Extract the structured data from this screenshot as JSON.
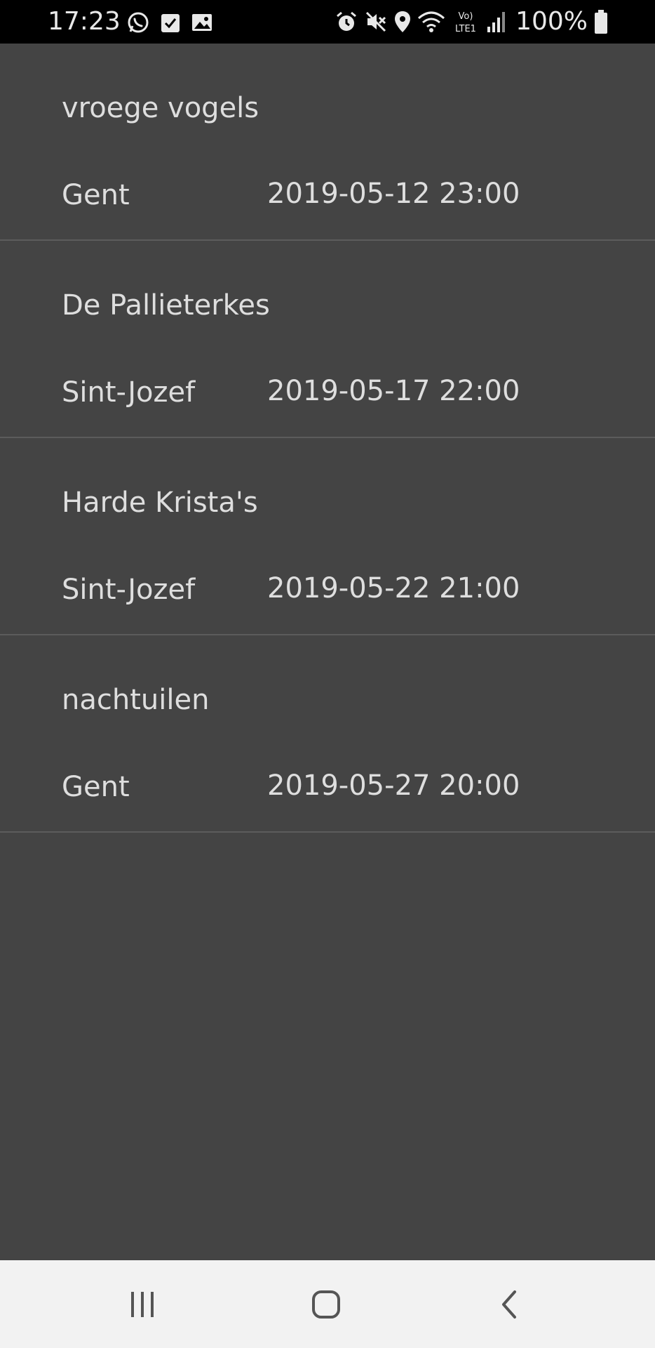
{
  "status_bar": {
    "time": "17:23",
    "battery_percent": "100%",
    "network_label_top": "Vo)",
    "network_label_bottom": "LTE1",
    "left_icons": [
      "whatsapp-icon",
      "checkbox-icon",
      "gallery-icon"
    ],
    "right_icons": [
      "alarm-icon",
      "mute-icon",
      "location-icon",
      "wifi-icon",
      "volte-icon",
      "signal-icon",
      "battery-icon"
    ]
  },
  "events": [
    {
      "title": "vroege vogels",
      "place": "Gent",
      "datetime": "2019-05-12 23:00"
    },
    {
      "title": "De Pallieterkes",
      "place": "Sint-Jozef",
      "datetime": "2019-05-17 22:00"
    },
    {
      "title": "Harde Krista's",
      "place": "Sint-Jozef",
      "datetime": "2019-05-22 21:00"
    },
    {
      "title": "nachtuilen",
      "place": "Gent",
      "datetime": "2019-05-27 20:00"
    }
  ],
  "nav_bar": {
    "buttons": [
      "recent-apps-icon",
      "home-icon",
      "back-icon"
    ]
  },
  "colors": {
    "background": "#444444",
    "text": "#dedede",
    "divider": "#5c5c5c",
    "status_bar": "#000000",
    "nav_bar": "#f2f2f2"
  }
}
